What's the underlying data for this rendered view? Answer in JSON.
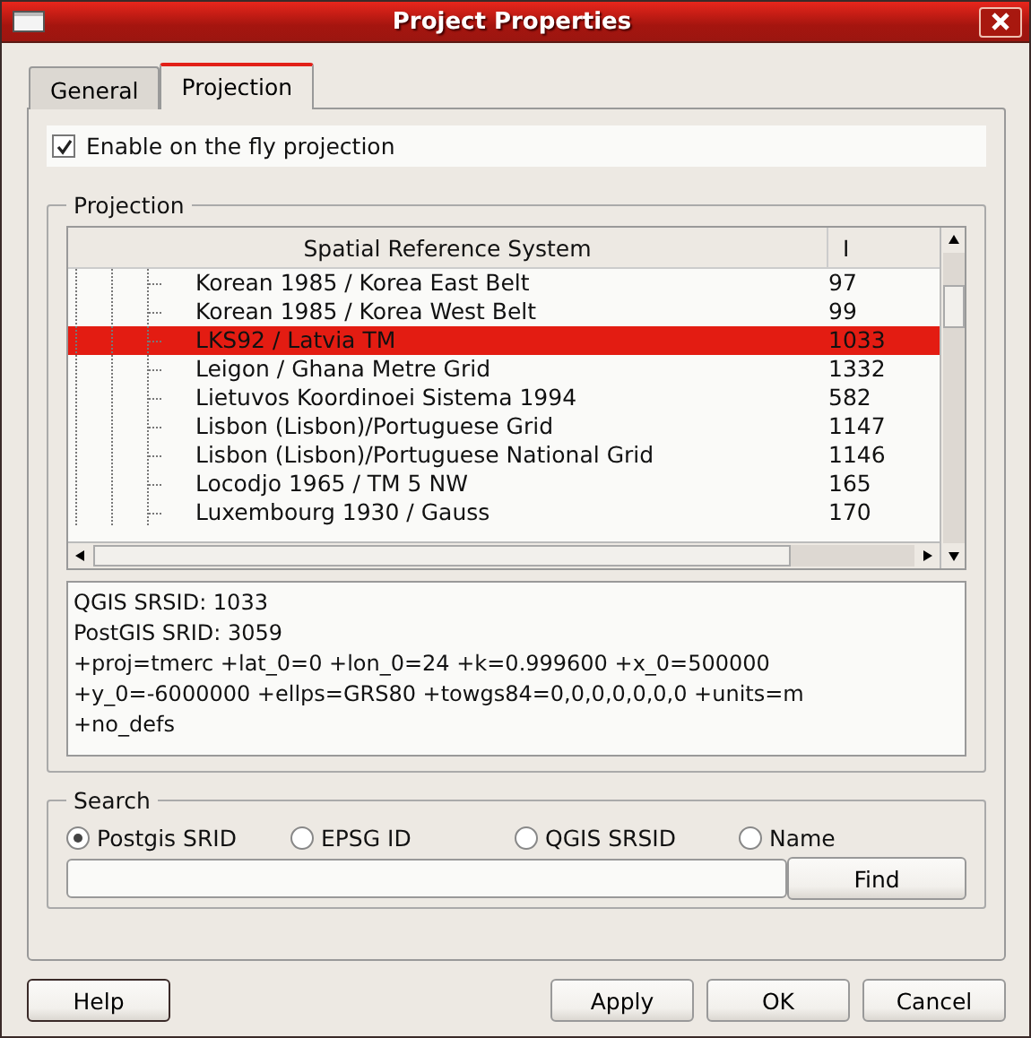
{
  "window": {
    "title": "Project Properties"
  },
  "tabs": [
    {
      "label": "General",
      "selected": false
    },
    {
      "label": "Projection",
      "selected": true
    }
  ],
  "fly_projection": {
    "label": "Enable on the fly projection",
    "checked": true
  },
  "projection": {
    "title": "Projection",
    "table": {
      "columns": [
        "Spatial Reference System",
        "I"
      ],
      "rows": [
        {
          "name": "Korean 1985 / Korea East Belt",
          "id": "97",
          "selected": false
        },
        {
          "name": "Korean 1985 / Korea West Belt",
          "id": "99",
          "selected": false
        },
        {
          "name": "LKS92 / Latvia TM",
          "id": "1033",
          "selected": true
        },
        {
          "name": "Leigon / Ghana Metre Grid",
          "id": "1332",
          "selected": false
        },
        {
          "name": "Lietuvos Koordinoei Sistema 1994",
          "id": "582",
          "selected": false
        },
        {
          "name": "Lisbon (Lisbon)/Portuguese Grid",
          "id": "1147",
          "selected": false
        },
        {
          "name": "Lisbon (Lisbon)/Portuguese National Grid",
          "id": "1146",
          "selected": false
        },
        {
          "name": "Locodjo 1965 / TM 5 NW",
          "id": "165",
          "selected": false
        },
        {
          "name": "Luxembourg 1930 / Gauss",
          "id": "170",
          "selected": false
        }
      ]
    },
    "info": [
      "QGIS SRSID: 1033",
      "PostGIS SRID: 3059",
      "+proj=tmerc +lat_0=0 +lon_0=24 +k=0.999600 +x_0=500000 +y_0=-6000000 +ellps=GRS80 +towgs84=0,0,0,0,0,0,0 +units=m +no_defs"
    ]
  },
  "search": {
    "title": "Search",
    "options": [
      {
        "label": "Postgis SRID",
        "selected": true
      },
      {
        "label": "EPSG ID",
        "selected": false
      },
      {
        "label": "QGIS SRSID",
        "selected": false
      },
      {
        "label": "Name",
        "selected": false
      }
    ],
    "find_button": "Find"
  },
  "buttons": {
    "help": "Help",
    "actions": [
      "Apply",
      "OK",
      "Cancel"
    ]
  }
}
